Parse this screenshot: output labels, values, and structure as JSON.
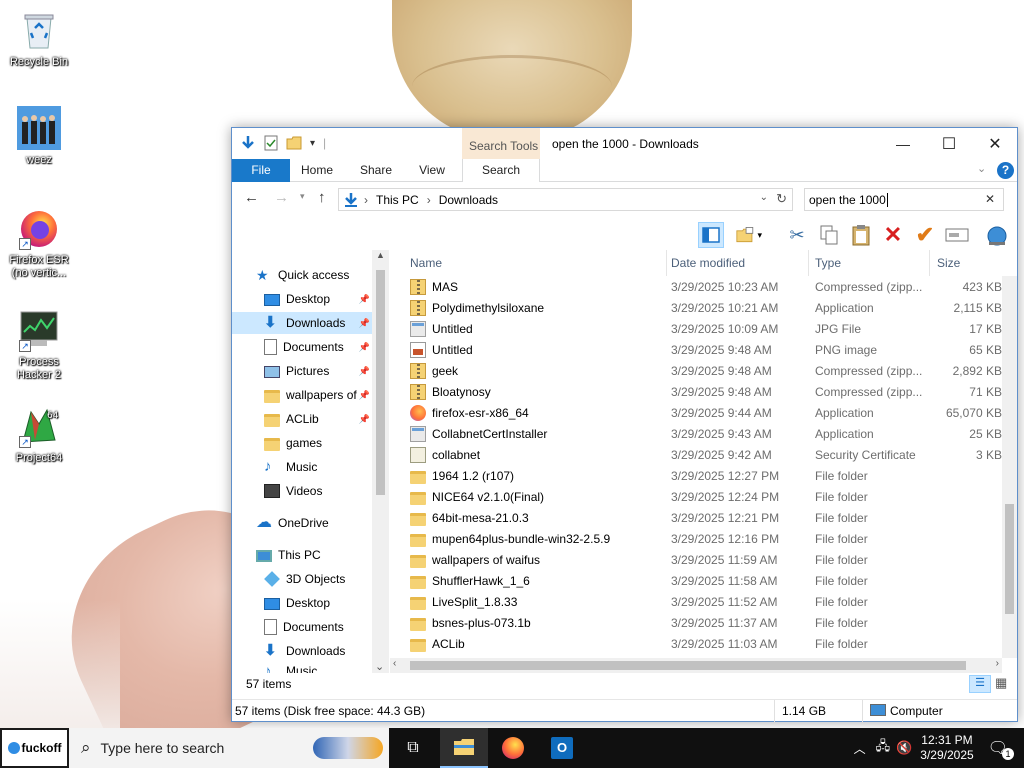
{
  "desktop": {
    "icons": [
      {
        "label": "Recycle Bin"
      },
      {
        "label": "weez"
      },
      {
        "label": "Firefox ESR (no vertic..."
      },
      {
        "label": "Process Hacker 2"
      },
      {
        "label": "Project64"
      }
    ]
  },
  "window": {
    "title": "open the 1000 - Downloads",
    "context_tab_group": "Search Tools",
    "tabs": [
      "File",
      "Home",
      "Share",
      "View",
      "Search"
    ],
    "controls": {
      "minimize": "—",
      "maximize": "☐",
      "close": "✕"
    },
    "help": "?"
  },
  "address": {
    "breadcrumb": [
      "This PC",
      "Downloads"
    ],
    "separator": "›"
  },
  "search": {
    "value": "open the 1000",
    "clear": "✕"
  },
  "nav": {
    "items": [
      {
        "label": "Quick access"
      },
      {
        "label": "Desktop"
      },
      {
        "label": "Downloads"
      },
      {
        "label": "Documents"
      },
      {
        "label": "Pictures"
      },
      {
        "label": "wallpapers of"
      },
      {
        "label": "ACLib"
      },
      {
        "label": "games"
      },
      {
        "label": "Music"
      },
      {
        "label": "Videos"
      },
      {
        "label": "OneDrive"
      },
      {
        "label": "This PC"
      },
      {
        "label": "3D Objects"
      },
      {
        "label": "Desktop"
      },
      {
        "label": "Documents"
      },
      {
        "label": "Downloads"
      },
      {
        "label": "Music"
      }
    ]
  },
  "columns": {
    "name": "Name",
    "date": "Date modified",
    "type": "Type",
    "size": "Size"
  },
  "files": [
    {
      "name": "MAS",
      "date": "3/29/2025 10:23 AM",
      "type": "Compressed (zipp...",
      "size": "423 KB",
      "icon": "zip"
    },
    {
      "name": "Polydimethylsiloxane",
      "date": "3/29/2025 10:21 AM",
      "type": "Application",
      "size": "2,115 KB",
      "icon": "zip"
    },
    {
      "name": "Untitled",
      "date": "3/29/2025 10:09 AM",
      "type": "JPG File",
      "size": "17 KB",
      "icon": "app"
    },
    {
      "name": "Untitled",
      "date": "3/29/2025 9:48 AM",
      "type": "PNG image",
      "size": "65 KB",
      "icon": "img"
    },
    {
      "name": "geek",
      "date": "3/29/2025 9:48 AM",
      "type": "Compressed (zipp...",
      "size": "2,892 KB",
      "icon": "zip"
    },
    {
      "name": "Bloatynosy",
      "date": "3/29/2025 9:48 AM",
      "type": "Compressed (zipp...",
      "size": "71 KB",
      "icon": "zip"
    },
    {
      "name": "firefox-esr-x86_64",
      "date": "3/29/2025 9:44 AM",
      "type": "Application",
      "size": "65,070 KB",
      "icon": "ffx"
    },
    {
      "name": "CollabnetCertInstaller",
      "date": "3/29/2025 9:43 AM",
      "type": "Application",
      "size": "25 KB",
      "icon": "app"
    },
    {
      "name": "collabnet",
      "date": "3/29/2025 9:42 AM",
      "type": "Security Certificate",
      "size": "3 KB",
      "icon": "cert"
    },
    {
      "name": "1964 1.2 (r107)",
      "date": "3/29/2025 12:27 PM",
      "type": "File folder",
      "size": "",
      "icon": "folder"
    },
    {
      "name": "NICE64 v2.1.0(Final)",
      "date": "3/29/2025 12:24 PM",
      "type": "File folder",
      "size": "",
      "icon": "folder"
    },
    {
      "name": "64bit-mesa-21.0.3",
      "date": "3/29/2025 12:21 PM",
      "type": "File folder",
      "size": "",
      "icon": "folder"
    },
    {
      "name": "mupen64plus-bundle-win32-2.5.9",
      "date": "3/29/2025 12:16 PM",
      "type": "File folder",
      "size": "",
      "icon": "folder"
    },
    {
      "name": "wallpapers of waifus",
      "date": "3/29/2025 11:59 AM",
      "type": "File folder",
      "size": "",
      "icon": "folder"
    },
    {
      "name": "ShufflerHawk_1_6",
      "date": "3/29/2025 11:58 AM",
      "type": "File folder",
      "size": "",
      "icon": "folder"
    },
    {
      "name": "LiveSplit_1.8.33",
      "date": "3/29/2025 11:52 AM",
      "type": "File folder",
      "size": "",
      "icon": "folder"
    },
    {
      "name": "bsnes-plus-073.1b",
      "date": "3/29/2025 11:37 AM",
      "type": "File folder",
      "size": "",
      "icon": "folder"
    },
    {
      "name": "ACLib",
      "date": "3/29/2025 11:03 AM",
      "type": "File folder",
      "size": "",
      "icon": "folder"
    }
  ],
  "status": {
    "count": "57 items",
    "detail": "57 items (Disk free space: 44.3 GB)",
    "size": "1.14 GB",
    "location": "Computer"
  },
  "taskbar": {
    "start_label": "fuckoff",
    "search_placeholder": "Type here to search",
    "clock_time": "12:31 PM",
    "clock_date": "3/29/2025",
    "notification_count": "1"
  },
  "colors": {
    "accent": "#1979ca",
    "selection": "#cce8ff",
    "taskbar": "#101010",
    "folder": "#f5d274",
    "context_tab": "#f9e8d4"
  }
}
